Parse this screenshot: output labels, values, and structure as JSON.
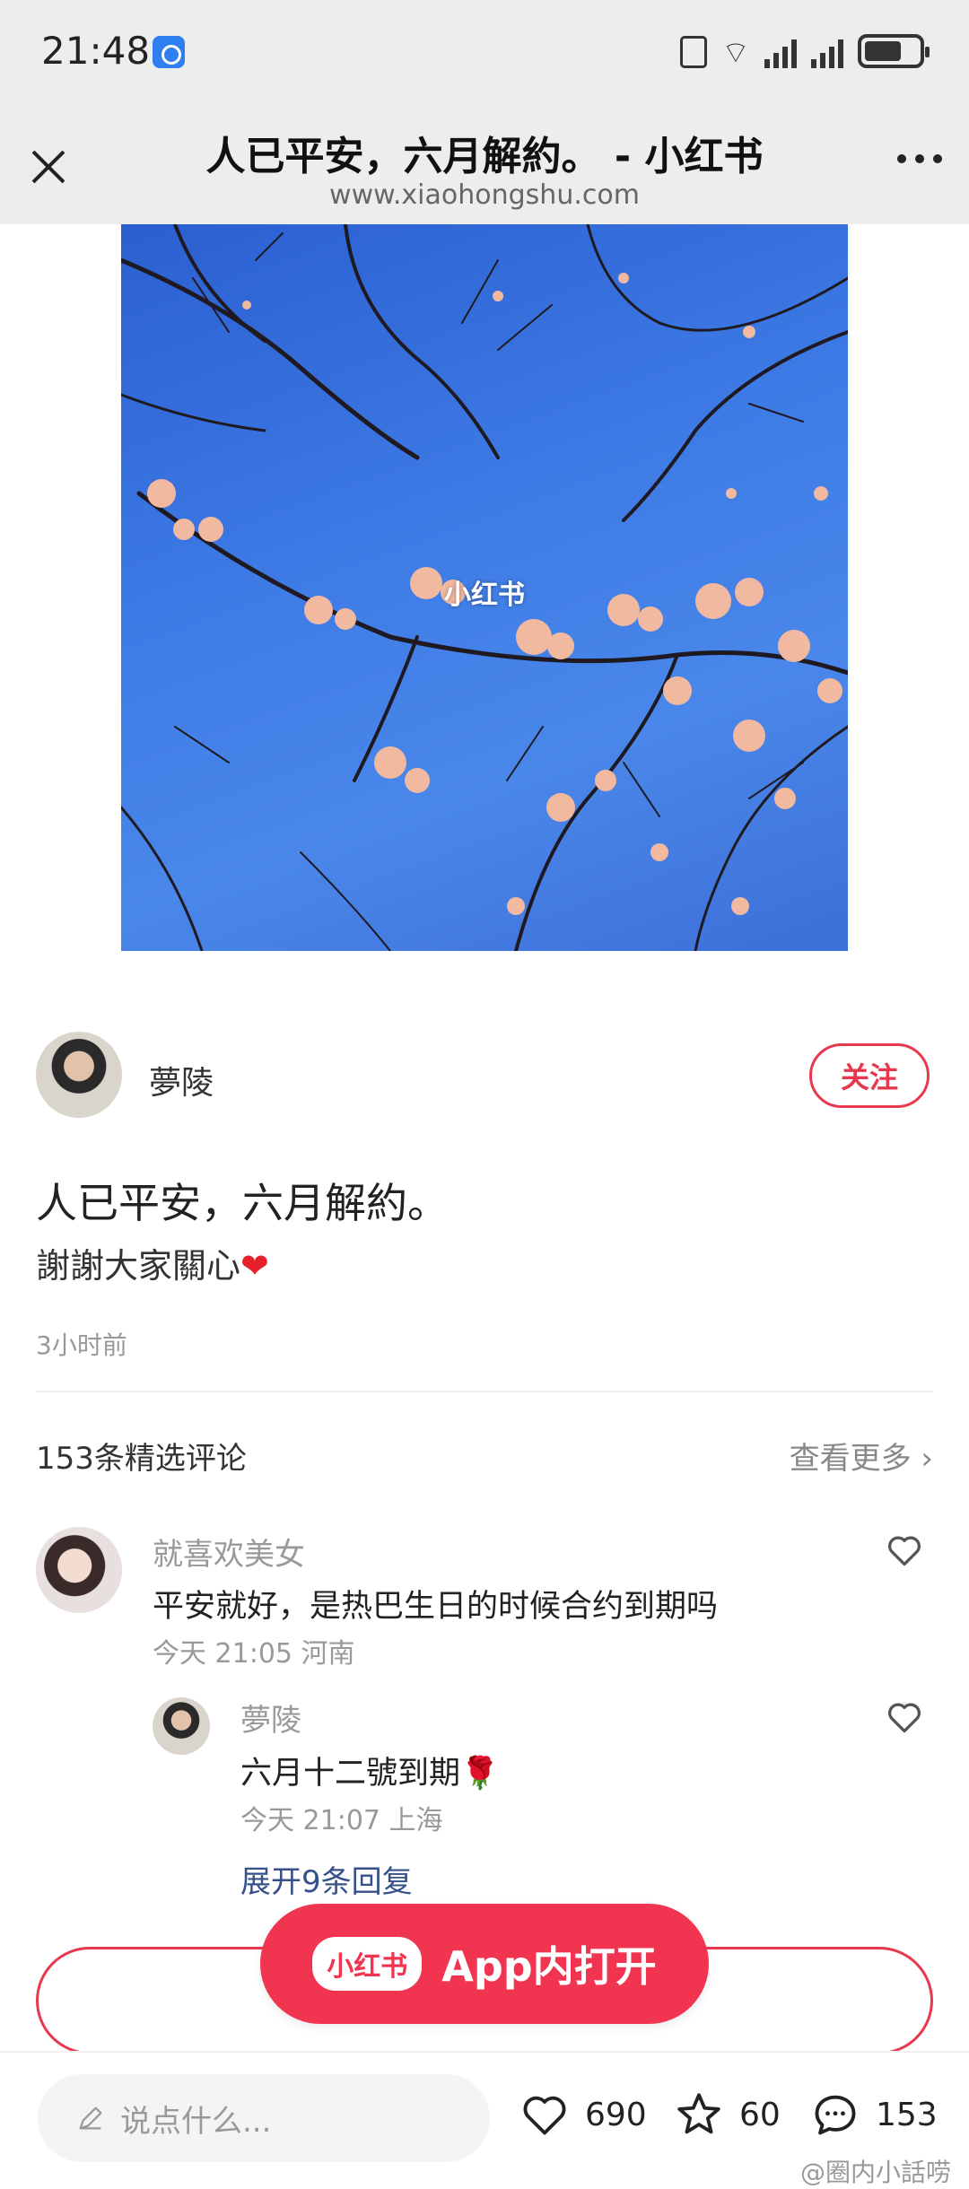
{
  "status_bar": {
    "time": "21:48"
  },
  "header": {
    "title": "人已平安，六月解約。 - 小红书",
    "url": "www.xiaohongshu.com"
  },
  "photo": {
    "watermark": "小红书"
  },
  "author": {
    "name": "夢陵",
    "follow_label": "关注"
  },
  "post": {
    "title": "人已平安，六月解約。",
    "body": "謝謝大家關心",
    "emoji": "❤",
    "time": "3小时前"
  },
  "comments_section": {
    "header": "153条精选评论",
    "view_more": "查看更多 ›"
  },
  "comments": [
    {
      "name": "就喜欢美女",
      "text": "平安就好，是热巴生日的时候合约到期吗",
      "meta": "今天 21:05 河南"
    },
    {
      "name": "夢陵",
      "text": "六月十二號到期🌹",
      "meta": "今天 21:07 上海"
    }
  ],
  "expand_replies": "展开9条回复",
  "open_app": {
    "logo": "小红书",
    "label": "App内打开"
  },
  "bottom_bar": {
    "input_placeholder": "说点什么...",
    "likes": "690",
    "stars": "60",
    "comments": "153"
  },
  "watermark_corner": "@圈内小話唠",
  "colors": {
    "accent": "#f13551",
    "link": "#36508a"
  }
}
